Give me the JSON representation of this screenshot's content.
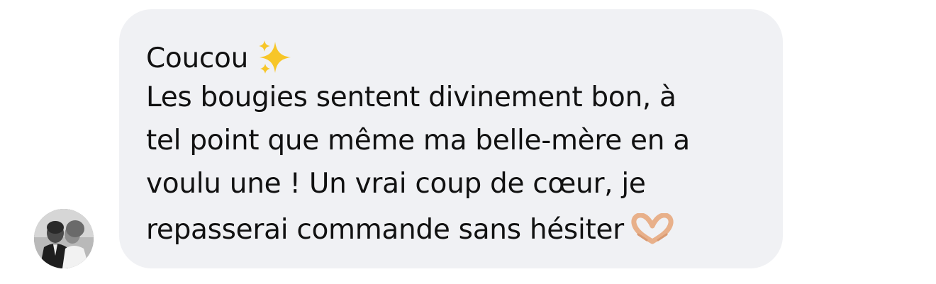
{
  "message": {
    "lines": [
      "Coucou",
      "Les bougies sentent divinement bon, à",
      "tel point que même ma belle-mère en a",
      "voulu une ! Un vrai coup de cœur, je",
      "repasserai commande sans hésiter"
    ],
    "emoji_after_line_1": "sparkles-icon",
    "emoji_after_line_5": "heart-hands-icon"
  },
  "colors": {
    "bubble_background": "#f0f1f4",
    "text": "#111111",
    "sparkle": "#f7c628",
    "heart_hands": "#e8b08a"
  }
}
